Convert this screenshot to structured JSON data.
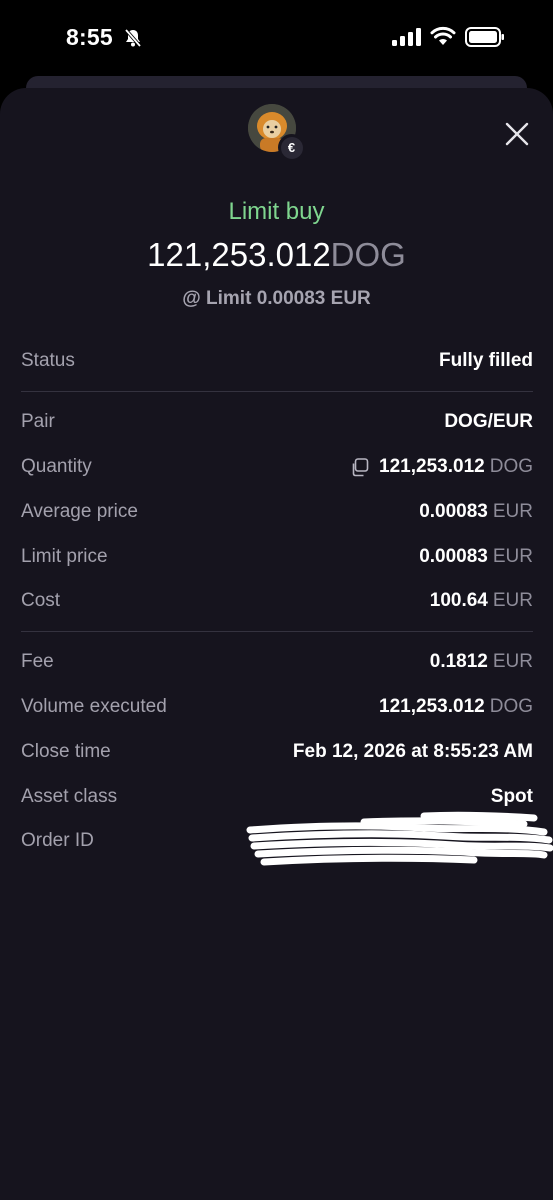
{
  "status_bar": {
    "time": "8:55",
    "icons": [
      "bell-slash-icon",
      "signal-icon",
      "wifi-icon",
      "battery-icon"
    ]
  },
  "header": {
    "avatar": "dog-avatar",
    "badge_symbol": "€",
    "close_icon": "close-icon"
  },
  "summary": {
    "order_type": "Limit buy",
    "amount": "121,253.012",
    "amount_unit": "DOG",
    "limit_text": "@ Limit 0.00083 EUR"
  },
  "details": {
    "status": {
      "label": "Status",
      "value": "Fully filled"
    },
    "pair": {
      "label": "Pair",
      "value": "DOG/EUR"
    },
    "quantity": {
      "label": "Quantity",
      "value": "121,253.012",
      "unit": "DOG"
    },
    "average_price": {
      "label": "Average price",
      "value": "0.00083",
      "unit": "EUR"
    },
    "limit_price": {
      "label": "Limit price",
      "value": "0.00083",
      "unit": "EUR"
    },
    "cost": {
      "label": "Cost",
      "value": "100.64",
      "unit": "EUR"
    },
    "fee": {
      "label": "Fee",
      "value": "0.1812",
      "unit": "EUR"
    },
    "volume_executed": {
      "label": "Volume executed",
      "value": "121,253.012",
      "unit": "DOG"
    },
    "close_time": {
      "label": "Close time",
      "value": "Feb 12, 2026 at 8:55:23 AM"
    },
    "asset_class": {
      "label": "Asset class",
      "value": "Spot"
    },
    "order_id": {
      "label": "Order ID",
      "value": ""
    }
  },
  "colors": {
    "accent_green": "#7fd68f",
    "sheet_bg": "#16141e",
    "muted_text": "#a3a1ad"
  }
}
